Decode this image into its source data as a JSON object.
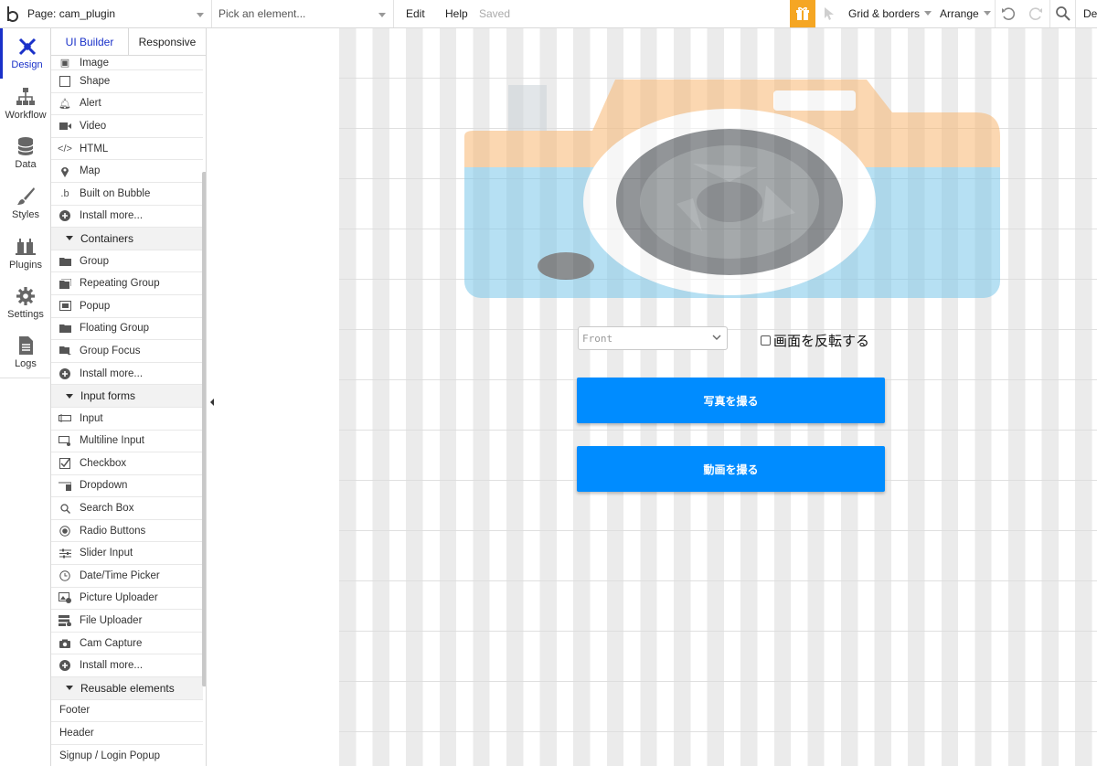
{
  "topbar": {
    "page_label": "Page: cam_plugin",
    "element_placeholder": "Pick an element...",
    "edit": "Edit",
    "help": "Help",
    "status": "Saved",
    "grid_borders": "Grid & borders",
    "arrange": "Arrange",
    "dev_truncated": "De"
  },
  "colors": {
    "accent_blue": "#1a31c9",
    "button_blue": "#008cff",
    "gift_orange": "#f5a623"
  },
  "nav": {
    "items": [
      {
        "label": "Design",
        "icon": "design-icon"
      },
      {
        "label": "Workflow",
        "icon": "workflow-icon"
      },
      {
        "label": "Data",
        "icon": "database-icon"
      },
      {
        "label": "Styles",
        "icon": "brush-icon"
      },
      {
        "label": "Plugins",
        "icon": "plug-icon"
      },
      {
        "label": "Settings",
        "icon": "gear-icon"
      },
      {
        "label": "Logs",
        "icon": "document-icon"
      }
    ]
  },
  "panel": {
    "tabs": [
      "UI Builder",
      "Responsive"
    ],
    "items": [
      {
        "label": "Image"
      },
      {
        "label": "Shape"
      },
      {
        "label": "Alert"
      },
      {
        "label": "Video"
      },
      {
        "label": "HTML"
      },
      {
        "label": "Map"
      },
      {
        "label": "Built on Bubble"
      },
      {
        "label": "Install more..."
      },
      {
        "section": "Containers"
      },
      {
        "label": "Group"
      },
      {
        "label": "Repeating Group"
      },
      {
        "label": "Popup"
      },
      {
        "label": "Floating Group"
      },
      {
        "label": "Group Focus"
      },
      {
        "label": "Install more..."
      },
      {
        "section": "Input forms"
      },
      {
        "label": "Input"
      },
      {
        "label": "Multiline Input"
      },
      {
        "label": "Checkbox"
      },
      {
        "label": "Dropdown"
      },
      {
        "label": "Search Box"
      },
      {
        "label": "Radio Buttons"
      },
      {
        "label": "Slider Input"
      },
      {
        "label": "Date/Time Picker"
      },
      {
        "label": "Picture Uploader"
      },
      {
        "label": "File Uploader"
      },
      {
        "label": "Cam Capture"
      },
      {
        "label": "Install more..."
      },
      {
        "section": "Reusable elements"
      },
      {
        "label": "Footer"
      },
      {
        "label": "Header"
      },
      {
        "label": "Signup / Login Popup"
      }
    ]
  },
  "canvas": {
    "dropdown_value": "Front",
    "checkbox_label": "画面を反転する",
    "button_photo": "写真を撮る",
    "button_video": "動画を撮る"
  }
}
